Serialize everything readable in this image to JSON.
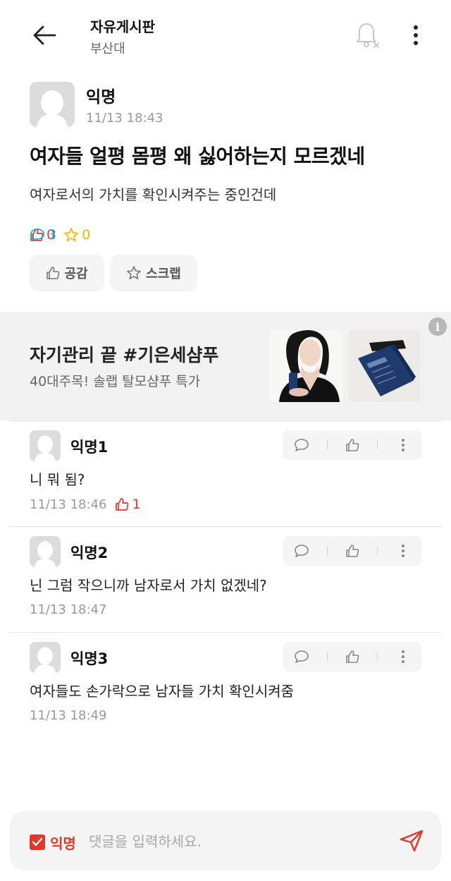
{
  "header": {
    "title": "자유게시판",
    "subtitle": "부산대"
  },
  "post": {
    "author": "익명",
    "time": "11/13 18:43",
    "title": "여자들 얼평 몸평 왜 싫어하는지 모르겠네",
    "body": "여자로서의 가치를 확인시켜주는 중인건데",
    "likes": "0",
    "comments": "3",
    "scraps": "0",
    "like_button": "공감",
    "scrap_button": "스크랩"
  },
  "ad": {
    "title": "자기관리 끝 #기은세샴푸",
    "subtitle": "40대주목! 솔랩 탈모샴푸 특가",
    "info": "i"
  },
  "comments": [
    {
      "author": "익명1",
      "text": "니 뭐 됨?",
      "time": "11/13 18:46",
      "likes": "1"
    },
    {
      "author": "익명2",
      "text": "닌 그럼 작으니까 남자로서 가치 없겠네?",
      "time": "11/13 18:47",
      "likes": ""
    },
    {
      "author": "익명3",
      "text": "여자들도 손가락으로 남자들 가치 확인시켜줌",
      "time": "11/13 18:49",
      "likes": ""
    }
  ],
  "input": {
    "anonymous_label": "익명",
    "placeholder": "댓글을 입력하세요."
  },
  "colors": {
    "like": "#e0382a",
    "comment": "#16a8d6",
    "scrap": "#f0b800",
    "placeholder": "#a8a8a8"
  }
}
